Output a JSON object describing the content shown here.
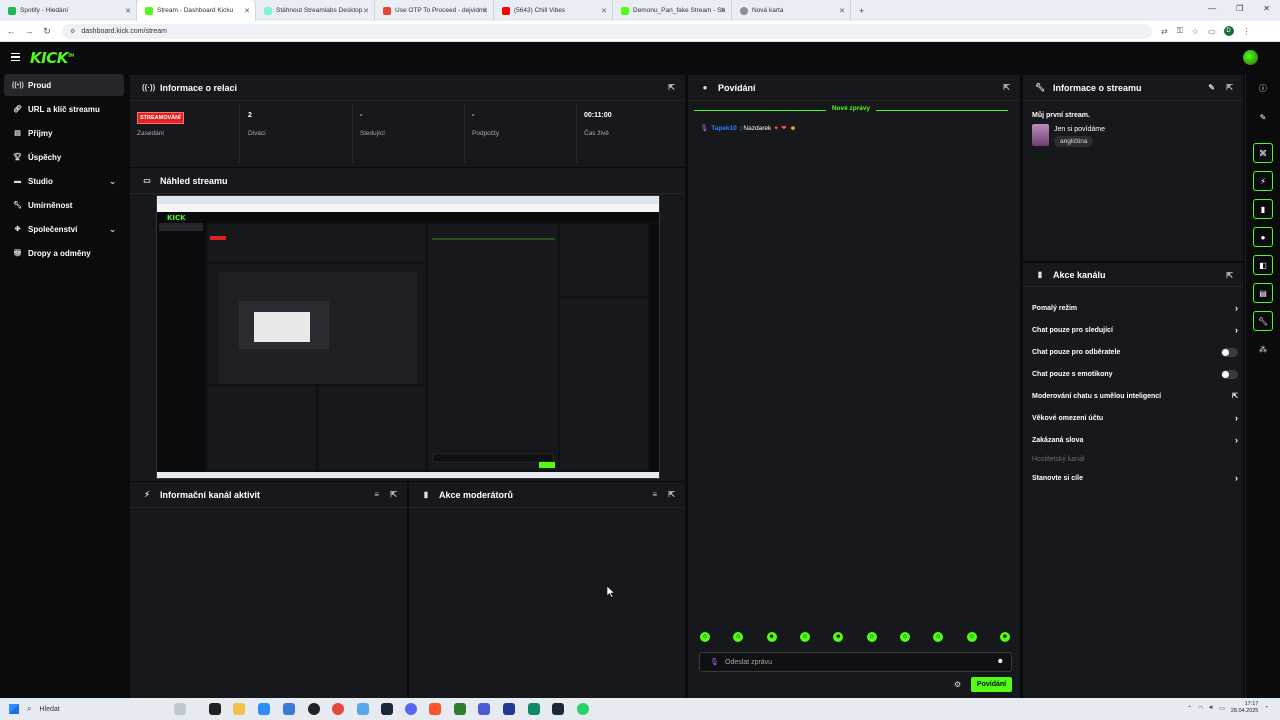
{
  "browser": {
    "tabs": [
      {
        "label": "Spotify - Hledání",
        "color": "#1db954"
      },
      {
        "label": "Stream - Dashboard Kicku",
        "color": "#53fc18"
      },
      {
        "label": "Stáhnout Streamlabs Desktop",
        "color": "#80f5d2"
      },
      {
        "label": "Use OTP To Proceed - dejvidml",
        "color": "#ea4335"
      },
      {
        "label": "(5643) Chill Vibes",
        "color": "#ff0000"
      },
      {
        "label": "Demonu_Pan_fake Stream - Sh",
        "color": "#53fc18"
      },
      {
        "label": "Nová karta",
        "color": "#5f6368"
      }
    ],
    "url": "dashboard.kick.com/stream",
    "profile_initial": "D"
  },
  "header": {
    "logo": "KICK",
    "logo_tm": "TM"
  },
  "sidebar": {
    "items": [
      {
        "label": "Proud",
        "icon": "broadcast-icon"
      },
      {
        "label": "URL a klíč streamu",
        "icon": "link-icon"
      },
      {
        "label": "Příjmy",
        "icon": "money-icon"
      },
      {
        "label": "Úspěchy",
        "icon": "trophy-icon"
      },
      {
        "label": "Studio",
        "icon": "studio-icon"
      },
      {
        "label": "Umírněnost",
        "icon": "wrench-icon"
      },
      {
        "label": "Společenství",
        "icon": "community-icon"
      },
      {
        "label": "Dropy a odměny",
        "icon": "gift-icon"
      }
    ]
  },
  "session": {
    "title": "Informace o relaci",
    "badge": "STREAMOVÁNÍ",
    "stats": [
      {
        "value": "",
        "label": "Zasedání"
      },
      {
        "value": "2",
        "label": "Diváci"
      },
      {
        "value": "-",
        "label": "Sledující"
      },
      {
        "value": "-",
        "label": "Podpočty"
      },
      {
        "value": "00:11:00",
        "label": "Čas živě"
      }
    ]
  },
  "preview": {
    "title": "Náhled streamu"
  },
  "activity": {
    "title": "Informační kanál aktivit"
  },
  "modactions": {
    "title": "Akce moderátorů"
  },
  "chat": {
    "title": "Povídání",
    "new_messages": "Nové zprávy",
    "message": {
      "user": "Tapek10",
      "text": ": Nazdarek"
    },
    "placeholder": "Odeslat zprávu",
    "send_label": "Povídání"
  },
  "streaminfo": {
    "title": "Informace o streamu",
    "stream_title": "Můj první stream.",
    "category": "Jen si povídáme",
    "tag": "angličtina"
  },
  "channel_actions": {
    "title": "Akce kanálu",
    "items": [
      {
        "label": "Pomalý režim",
        "control": "chevron"
      },
      {
        "label": "Chat pouze pro sledující",
        "control": "chevron"
      },
      {
        "label": "Chat pouze pro odběratele",
        "control": "toggle"
      },
      {
        "label": "Chat pouze s emotikony",
        "control": "toggle"
      },
      {
        "label": "Moderování chatu s umělou inteligencí",
        "control": "external"
      },
      {
        "label": "Věkové omezení účtu",
        "control": "chevron"
      },
      {
        "label": "Zakázaná slova",
        "control": "chevron"
      },
      {
        "label": "Hostitelský kanál",
        "control": "none"
      },
      {
        "label": "Stanovte si cíle",
        "control": "chevron"
      }
    ]
  },
  "taskbar": {
    "search": "Hledat",
    "time": "17:17",
    "date": "28.04.2025"
  },
  "colors": {
    "accent": "#53fc18",
    "live": "#e0231e",
    "panel": "#17181b",
    "bg": "#0b0b0d"
  }
}
